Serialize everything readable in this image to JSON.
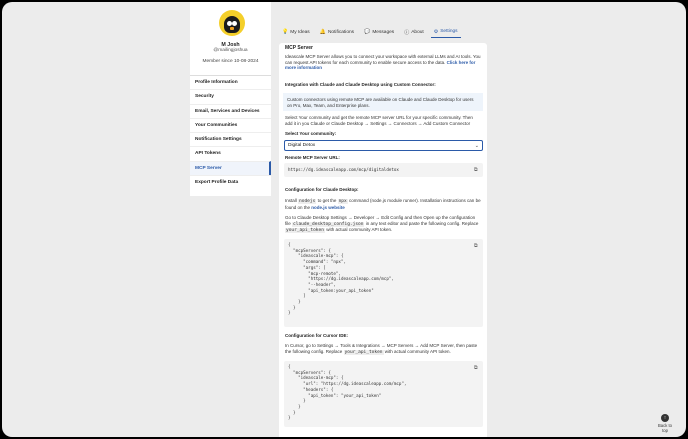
{
  "user": {
    "name": "M Josh",
    "handle": "@mailingjoshua",
    "member_since": "Member since 10-08-2024"
  },
  "sidebar": {
    "items": [
      {
        "label": "Profile Information",
        "active": false
      },
      {
        "label": "Security",
        "active": false
      },
      {
        "label": "Email, Services and Devices",
        "active": false
      },
      {
        "label": "Your Communities",
        "active": false
      },
      {
        "label": "Notification Settings",
        "active": false
      },
      {
        "label": "API Tokens",
        "active": false
      },
      {
        "label": "MCP Server",
        "active": true
      },
      {
        "label": "Export Profile Data",
        "active": false
      }
    ]
  },
  "tabs": [
    {
      "label": "My Ideas",
      "icon": "lightbulb-icon"
    },
    {
      "label": "Notifications",
      "icon": "bell-icon"
    },
    {
      "label": "Messages",
      "icon": "chat-icon"
    },
    {
      "label": "About",
      "icon": "info-icon"
    },
    {
      "label": "Settings",
      "icon": "gear-icon",
      "active": true
    }
  ],
  "mcp": {
    "title": "MCP Server",
    "intro": "Ideascale MCP Server allows you to connect your workspace with external LLMs and AI tools. You can request API tokens for each community to enable secure access to the data.",
    "intro_link": "Click here for more information",
    "claude_heading": "Integration with Claude and Claude Desktop using Custom Connector:",
    "claude_info": "Custom connectors using remote MCP are available on Claude and Claude Desktop for users on Pro, Max, Team, and Enterprise plans.",
    "claude_select_text": "Select Your community and get the remote MCP server URL for your specific community. Then add it in you Claude or Claude Desktop → Settings → Connectors → Add Custom Connector",
    "select_label": "Select Your community:",
    "select_value": "Digital Detox",
    "url_label": "Remote MCP Server URL:",
    "url_value": "https://dg.ideascaleapp.com/mcp/digitaldetox",
    "desktop_heading": "Configuration for Claude Desktop:",
    "desktop_install_1": "Install",
    "desktop_install_node": "nodejs",
    "desktop_install_2": "to get the",
    "desktop_install_npx": "npx",
    "desktop_install_3": "command (node.js module runner). Installation instructions can be found on the",
    "desktop_install_link": "node.js website",
    "desktop_goto_1": "Go to Claude Desktop Settings → Developer → Edit Config and then Open up the configuration file",
    "desktop_goto_file": "claude_desktop_config.json",
    "desktop_goto_2": "in any text editor and paste the following config. Replace",
    "desktop_goto_token": "your_api_token",
    "desktop_goto_3": "with actual community API token.",
    "desktop_code": "{\n  \"mcpServers\": {\n    \"ideascale-mcp\": {\n      \"command\": \"npx\",\n      \"args\": [\n        \"mcp-remote\",\n        \"https://dg.ideascaleapp.com/mcp\",\n        \"--header\",\n        \"api_token:your_api_token\"\n      ]\n    }\n  }\n}",
    "cursor_heading": "Configuration for Cursor IDE:",
    "cursor_text_1": "In Cursor, go to Settings → Tools & Integrations → MCP Servers → Add MCP Server, then paste the following config. Replace",
    "cursor_token": "your_api_token",
    "cursor_text_2": "with actual community API token.",
    "cursor_code": "{\n  \"mcpServers\": {\n    \"ideascale-mcp\": {\n      \"url\": \"https://dg.ideascaleapp.com/mcp\",\n      \"headers\": {\n        \"api_token\": \"your_api_token\"\n      }\n    }\n  }\n}"
  },
  "back_to_top": "Back to top"
}
